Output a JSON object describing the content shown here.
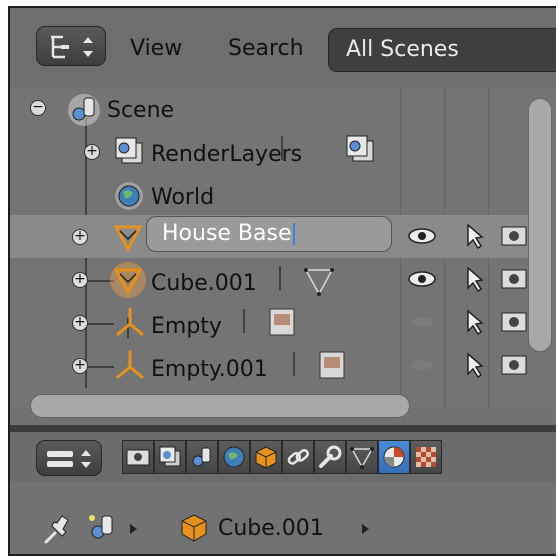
{
  "outliner_header": {
    "menu_view": "View",
    "menu_search": "Search",
    "display_mode": "All Scenes"
  },
  "tree": {
    "scene": "Scene",
    "render_layers": "RenderLayers",
    "world": "World",
    "rename_value": "House Base",
    "cube": "Cube.001",
    "empty": "Empty",
    "empty_001": "Empty.001"
  },
  "breadcrumb": {
    "object": "Cube.001"
  },
  "colors": {
    "background": "#727272",
    "active_tab": "#4b8ad6",
    "rename_field": "#9a9a9a",
    "mesh_orange": "#e8901e"
  },
  "icons": [
    "outliner-editor-icon",
    "scene-icon",
    "renderlayers-icon",
    "world-icon",
    "mesh-icon",
    "empty-icon",
    "eye-icon",
    "cursor-icon",
    "camera-icon",
    "render-tab-icon",
    "layers-tab-icon",
    "scene-tab-icon",
    "world-tab-icon",
    "object-tab-icon",
    "constraints-tab-icon",
    "modifier-tab-icon",
    "data-tab-icon",
    "material-tab-icon",
    "texture-tab-icon",
    "pin-icon"
  ]
}
